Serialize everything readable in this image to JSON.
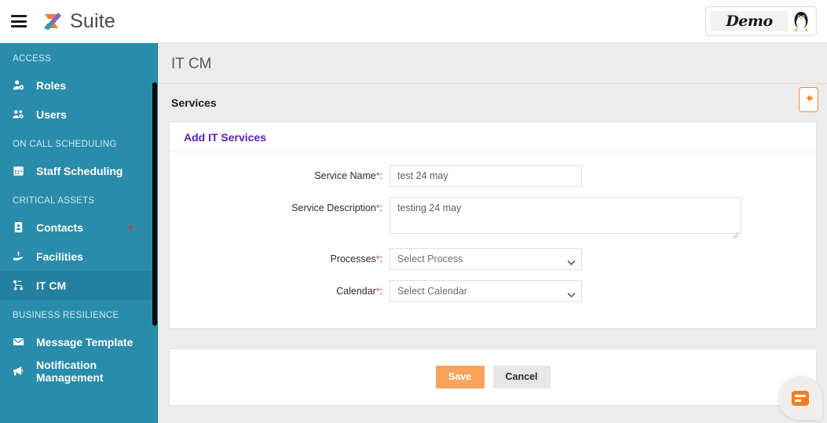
{
  "topbar": {
    "menu_icon": "hamburger-icon",
    "brand_name": "Suite",
    "brand_logo": "z-logo-icon",
    "tenant_label": "Demo",
    "avatar_icon": "penguin-avatar-icon"
  },
  "sidebar": {
    "groups": [
      {
        "heading": "ACCESS",
        "items": [
          {
            "label": "Roles",
            "icon": "user-cog-icon",
            "active": false,
            "badge": false
          },
          {
            "label": "Users",
            "icon": "users-cog-icon",
            "active": false,
            "badge": false
          }
        ]
      },
      {
        "heading": "ON CALL SCHEDULING",
        "items": [
          {
            "label": "Staff Scheduling",
            "icon": "calendar-icon",
            "active": false,
            "badge": false
          }
        ]
      },
      {
        "heading": "CRITICAL ASSETS",
        "items": [
          {
            "label": "Contacts",
            "icon": "contact-card-icon",
            "active": false,
            "badge": true
          },
          {
            "label": "Facilities",
            "icon": "hand-holding-icon",
            "active": false,
            "badge": false
          },
          {
            "label": "IT CM",
            "icon": "sitemap-icon",
            "active": true,
            "badge": false
          }
        ]
      },
      {
        "heading": "BUSINESS RESILIENCE",
        "items": [
          {
            "label": "Message Template",
            "icon": "envelope-icon",
            "active": false,
            "badge": false
          },
          {
            "label": "Notification Management",
            "icon": "bullhorn-icon",
            "active": false,
            "badge": false
          }
        ]
      }
    ]
  },
  "main": {
    "page_title": "IT CM",
    "section_title": "Services",
    "back_button_icon": "arrow-left-icon",
    "card_title": "Add IT Services",
    "fields": [
      {
        "label": "Service Name",
        "required": "*",
        "colon": ":",
        "type": "text",
        "value": "test 24 may",
        "placeholder": ""
      },
      {
        "label": "Service Description",
        "required": "*",
        "colon": ":",
        "type": "textarea",
        "value": "testing 24 may",
        "placeholder": ""
      },
      {
        "label": "Processes",
        "required": "*",
        "colon": ":",
        "type": "select",
        "value": "Select Process",
        "options": [
          "Select Process"
        ]
      },
      {
        "label": "Calendar",
        "required": "*",
        "colon": ":",
        "type": "select",
        "value": "Select Calendar",
        "options": [
          "Select Calendar"
        ]
      }
    ],
    "actions": {
      "save_label": "Save",
      "cancel_label": "Cancel"
    },
    "chat_widget_icon": "chat-bubble-icon"
  },
  "colors": {
    "sidebar": "#2a8cab",
    "sidebar_active": "#24809e",
    "accent_orange": "#f7a35c",
    "card_title_purple": "#5b21b6",
    "required_red": "#e03a2f",
    "page_bg": "#ececec"
  }
}
